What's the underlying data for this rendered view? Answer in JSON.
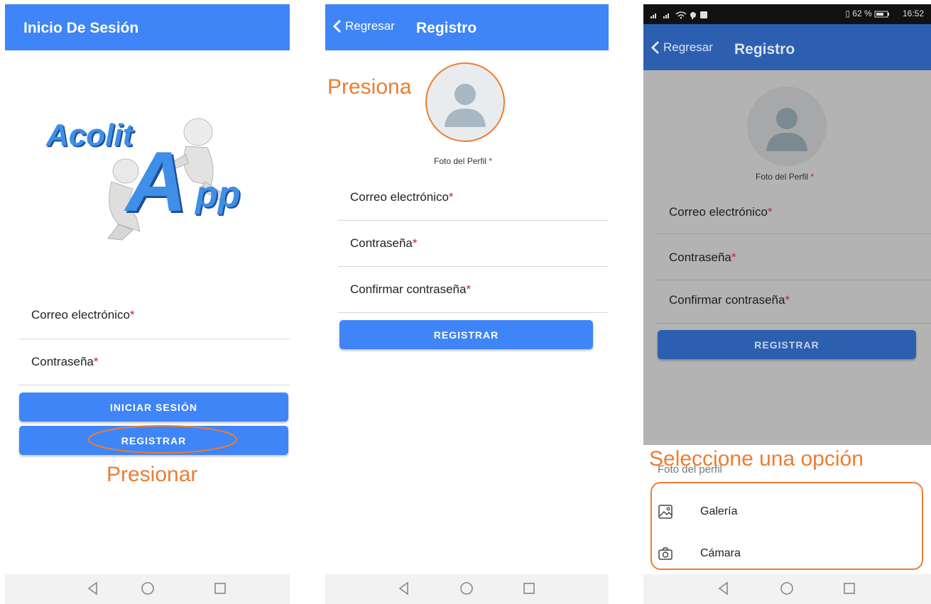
{
  "screen1": {
    "title": "Inicio De Sesión",
    "logo_text": "Acolit",
    "logo_text_big": "A",
    "logo_text_small": "pp",
    "email_label": "Correo electrónico",
    "password_label": "Contraseña",
    "required_mark": "*",
    "login_button": "INICIAR SESIÓN",
    "register_button": "REGISTRAR",
    "annotation": "Presionar"
  },
  "screen2": {
    "back_label": "Regresar",
    "title": "Registro",
    "annotation": "Presiona",
    "photo_label": "Foto del Perfil",
    "required_mark": "*",
    "email_label": "Correo electrónico",
    "password_label": "Contraseña",
    "confirm_label": "Confirmar contraseña",
    "register_button": "REGISTRAR"
  },
  "screen3": {
    "status": {
      "battery": "62 %",
      "time": "16:52"
    },
    "back_label": "Regresar",
    "title": "Registro",
    "photo_label": "Foto del Perfil",
    "required_mark": "*",
    "email_label": "Correo electrónico",
    "password_label": "Contraseña",
    "confirm_label": "Confirmar contraseña",
    "register_button": "REGISTRAR",
    "annotation": "Seleccione una opción",
    "sheet_title": "Foto del perfil",
    "options": [
      {
        "label": "Galería",
        "icon": "image-icon"
      },
      {
        "label": "Cámara",
        "icon": "camera-icon"
      }
    ]
  },
  "colors": {
    "primary": "#3f85f7",
    "primary_dimmed": "#2d5fb1",
    "annotation": "#ed7d31",
    "required": "#c2185b"
  }
}
